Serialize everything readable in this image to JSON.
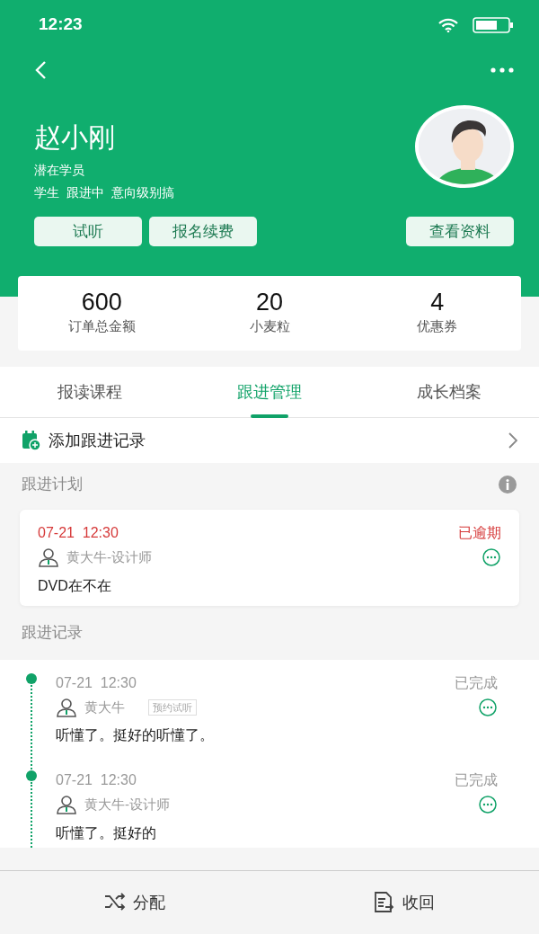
{
  "status_bar": {
    "time": "12:23"
  },
  "profile": {
    "name": "赵小刚",
    "type": "潜在学员",
    "tags": [
      "学生",
      "跟进中",
      "意向级别搞"
    ],
    "actions": [
      "试听",
      "报名续费"
    ],
    "secondary_action": "查看资料"
  },
  "stats": [
    {
      "value": "600",
      "label": "订单总金额"
    },
    {
      "value": "20",
      "label": "小麦粒"
    },
    {
      "value": "4",
      "label": "优惠券"
    }
  ],
  "tabs": [
    {
      "label": "报读课程",
      "selected": false
    },
    {
      "label": "跟进管理",
      "selected": true
    },
    {
      "label": "成长档案",
      "selected": false
    }
  ],
  "add_record": {
    "label": "添加跟进记录"
  },
  "plan": {
    "title": "跟进计划",
    "items": [
      {
        "date": "07-21  12:30",
        "status": "已逾期",
        "overdue": true,
        "person": "黄大牛-设计师",
        "note": "DVD在不在"
      }
    ]
  },
  "records": {
    "title": "跟进记录",
    "items": [
      {
        "date": "07-21  12:30",
        "status": "已完成",
        "overdue": false,
        "person": "黄大牛",
        "tag": "预约试听",
        "note": "听懂了。挺好的听懂了。"
      },
      {
        "date": "07-21  12:30",
        "status": "已完成",
        "overdue": false,
        "person": "黄大牛-设计师",
        "note": "听懂了。挺好的"
      }
    ]
  },
  "bottom_bar": [
    {
      "label": "分配",
      "kind": "shuffle"
    },
    {
      "label": "收回",
      "kind": "document"
    }
  ]
}
